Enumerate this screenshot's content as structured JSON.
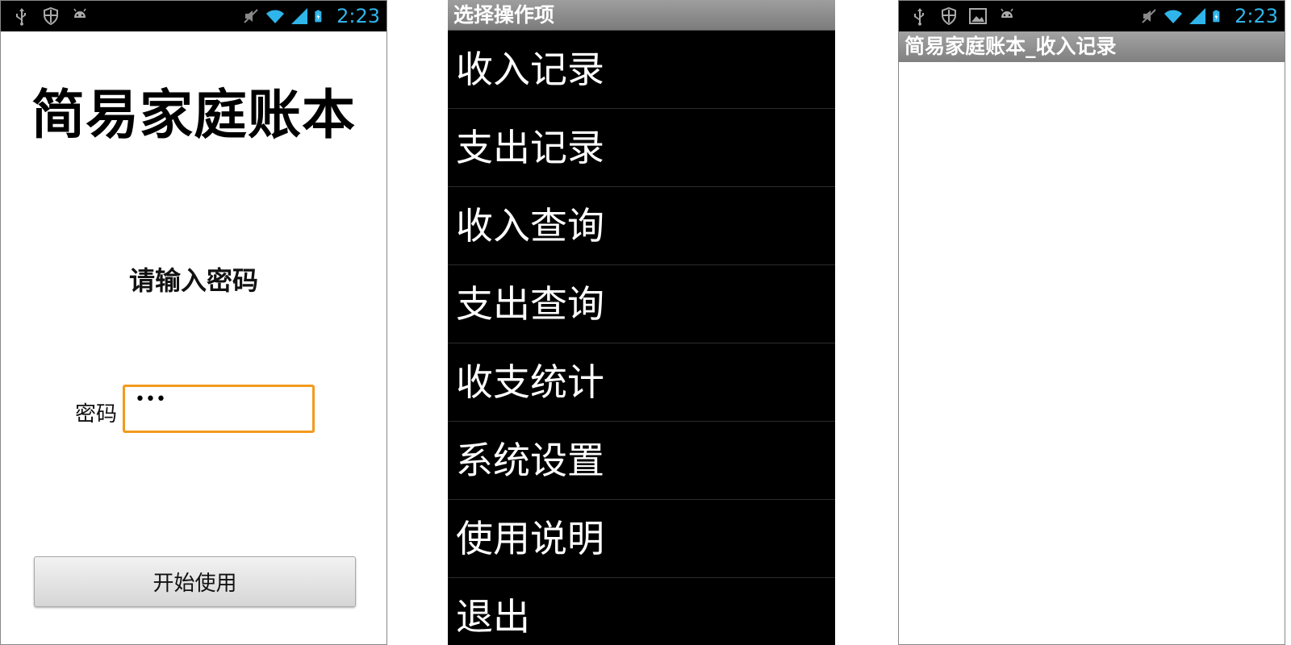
{
  "status": {
    "time": "2:23",
    "accent": "#2fb5ea",
    "left_icons_login": [
      "usb-icon",
      "shield-icon",
      "android-icon"
    ],
    "left_icons_record": [
      "usb-icon",
      "shield-icon",
      "image-icon",
      "android-icon"
    ],
    "right_icons": [
      "mute-icon",
      "wifi-icon",
      "signal-icon",
      "battery-icon"
    ]
  },
  "login": {
    "app_title": "简易家庭账本",
    "prompt": "请输入密码",
    "password_label": "密码",
    "password_value": "•••",
    "start_button": "开始使用",
    "focus_color": "#f39a1e"
  },
  "menu": {
    "title": "选择操作项",
    "items": [
      "收入记录",
      "支出记录",
      "收入查询",
      "支出查询",
      "收支统计",
      "系统设置",
      "使用说明",
      "退出"
    ]
  },
  "record": {
    "title": "简易家庭账本_收入记录"
  }
}
